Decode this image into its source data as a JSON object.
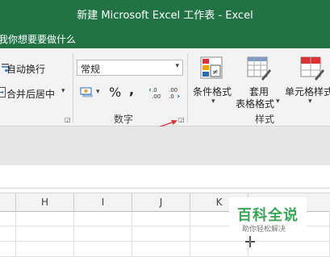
{
  "window": {
    "title": "新建 Microsoft Excel 工作表  -  Excel"
  },
  "tell_me": {
    "text": "我你想要要做什么"
  },
  "ribbon": {
    "alignment": {
      "wrap_text": "自动换行",
      "merge_center": "合并后居中",
      "merge_arrow": "▾"
    },
    "number": {
      "format_value": "常规",
      "format_arrow": "▾",
      "percent": "%",
      "comma": ",",
      "group_label": "数字",
      "currency_arrow": "▾"
    },
    "styles": {
      "conditional_format": "条件格式",
      "format_table_line1": "套用",
      "format_table_line2": "表格格式",
      "cell_styles": "单元格样式",
      "dropdown_arrow": "▾",
      "group_label": "样式"
    }
  },
  "columns": [
    "H",
    "I",
    "J",
    "K"
  ],
  "watermark": {
    "brand": "百科全说",
    "tagline": "助你轻松解决"
  },
  "colors": {
    "excel_green": "#217346",
    "annotation_arrow": "#e03131",
    "watermark_green": "#3aa655"
  }
}
